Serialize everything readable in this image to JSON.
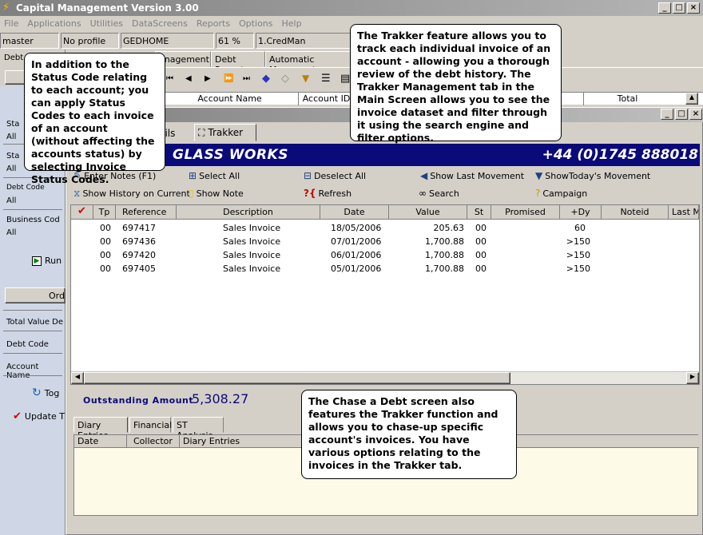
{
  "app": {
    "title": "Capital Management Version 3.00"
  },
  "window_buttons": [
    "_",
    "□",
    "×"
  ],
  "menu": [
    "File",
    "Applications",
    "Utilities",
    "DataScreens",
    "Reports",
    "Options",
    "Help"
  ],
  "status": [
    "master",
    "No profile",
    "GEDHOME",
    "61 %",
    "1.CredMan"
  ],
  "top_tabs": [
    "Debt",
    "anagement",
    "Debt Report",
    "Automatic Movement"
  ],
  "header_cols": [
    "Account Name",
    "Account ID",
    "Total"
  ],
  "left_panel": {
    "items": [
      {
        "label": "Sta",
        "value": "All"
      },
      {
        "label": "Sta",
        "value": "All"
      },
      {
        "label": "Debt Code",
        "value": "All"
      },
      {
        "label": "Business Cod",
        "value": "All"
      }
    ],
    "run": "Run",
    "order": "Ord",
    "fields": [
      "Total Value De",
      "Debt Code",
      "Account Name"
    ],
    "tog": "Tog",
    "update": "Update T"
  },
  "inner": {
    "tabs": [
      "etails",
      "Trakker"
    ],
    "company": "GLASS WORKS",
    "phone": "+44 (0)1745 888018",
    "actions": {
      "enter_notes": "Enter Notes  (F1)",
      "select_all": "Select All",
      "deselect_all": "Deselect All",
      "show_last_movement": "Show Last Movement",
      "show_today_movement": "ShowToday's Movement",
      "show_history": "Show History on Current",
      "show_note": "Show Note",
      "refresh": "Refresh",
      "search": "Search",
      "campaign": "Campaign"
    },
    "grid": {
      "headers": [
        "Tp",
        "Reference",
        "Description",
        "Date",
        "Value",
        "St",
        "Promised",
        "+Dy",
        "Noteid",
        "Last Mc"
      ],
      "rows": [
        {
          "tp": "00",
          "ref": "697417",
          "desc": "Sales Invoice",
          "date": "18/05/2006",
          "value": "205.63",
          "st": "00",
          "dy": "60"
        },
        {
          "tp": "00",
          "ref": "697436",
          "desc": "Sales Invoice",
          "date": "07/01/2006",
          "value": "1,700.88",
          "st": "00",
          "dy": ">150"
        },
        {
          "tp": "00",
          "ref": "697420",
          "desc": "Sales Invoice",
          "date": "06/01/2006",
          "value": "1,700.88",
          "st": "00",
          "dy": ">150"
        },
        {
          "tp": "00",
          "ref": "697405",
          "desc": "Sales Invoice",
          "date": "05/01/2006",
          "value": "1,700.88",
          "st": "00",
          "dy": ">150"
        }
      ]
    },
    "outstanding_label": "Outstanding Amount",
    "outstanding_value": "5,308.27",
    "bottom_tabs": [
      "Diary Entries",
      "Financial",
      "ST Analysis"
    ],
    "bottom_headers": [
      "Date",
      "Collector",
      "Diary Entries"
    ]
  },
  "callouts": {
    "left": "In addition to the Status Code relating to each account; you can apply Status Codes to each invoice of an account (without affecting the accounts status) by selecting Invoice Status Codes.",
    "top": "The Trakker feature allows you to track each individual invoice of an account - allowing you a thorough review of the debt history. The Trakker Management tab in the Main Screen allows you to see the invoice dataset and filter through it using the search engine and filter options.",
    "bottom": "The Chase a Debt screen also features the Trakker function and allows you to chase-up specific account's invoices. You have various options relating to the invoices in the Trakker tab."
  }
}
